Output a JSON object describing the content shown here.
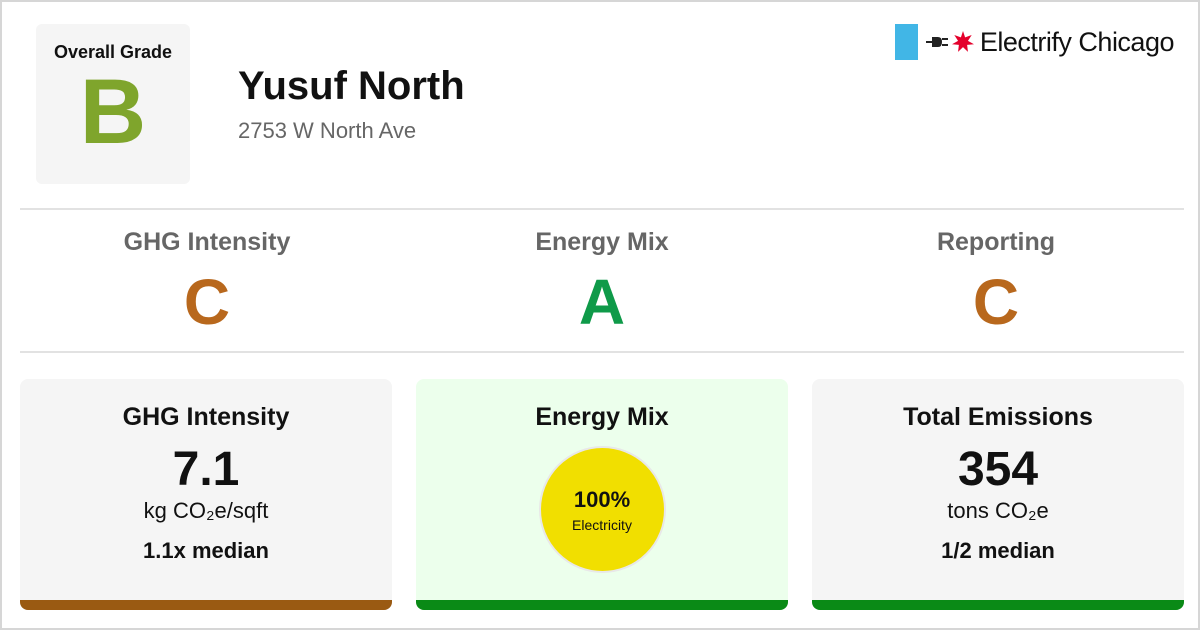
{
  "header": {
    "overall_label": "Overall Grade",
    "overall_grade": "B",
    "building_name": "Yusuf North",
    "address": "2753 W North Ave",
    "brand_name": "Electrify Chicago"
  },
  "grades": [
    {
      "label": "GHG Intensity",
      "grade": "C",
      "color": "#b8681d"
    },
    {
      "label": "Energy Mix",
      "grade": "A",
      "color": "#0f9a49"
    },
    {
      "label": "Reporting",
      "grade": "C",
      "color": "#b8681d"
    }
  ],
  "cards": {
    "ghg": {
      "title": "GHG Intensity",
      "value": "7.1",
      "unit": "kg CO₂e/sqft",
      "median": "1.1x median",
      "bar_color": "#9a5a12"
    },
    "mix": {
      "title": "Energy Mix",
      "percent": "100%",
      "source": "Electricity",
      "bar_color": "#0a8a16"
    },
    "emissions": {
      "title": "Total Emissions",
      "value": "354",
      "unit": "tons CO₂e",
      "median": "1/2 median",
      "bar_color": "#0a8a16"
    }
  },
  "colors": {
    "overall_grade": "#7fa52c",
    "flag_blue": "#41b6e6",
    "star_red": "#e4002b",
    "mix_circle": "#f1df00"
  },
  "icons": {
    "flag_bar": "chicago-flag-bar-icon",
    "plug": "plug-icon",
    "star": "chicago-star-icon"
  }
}
